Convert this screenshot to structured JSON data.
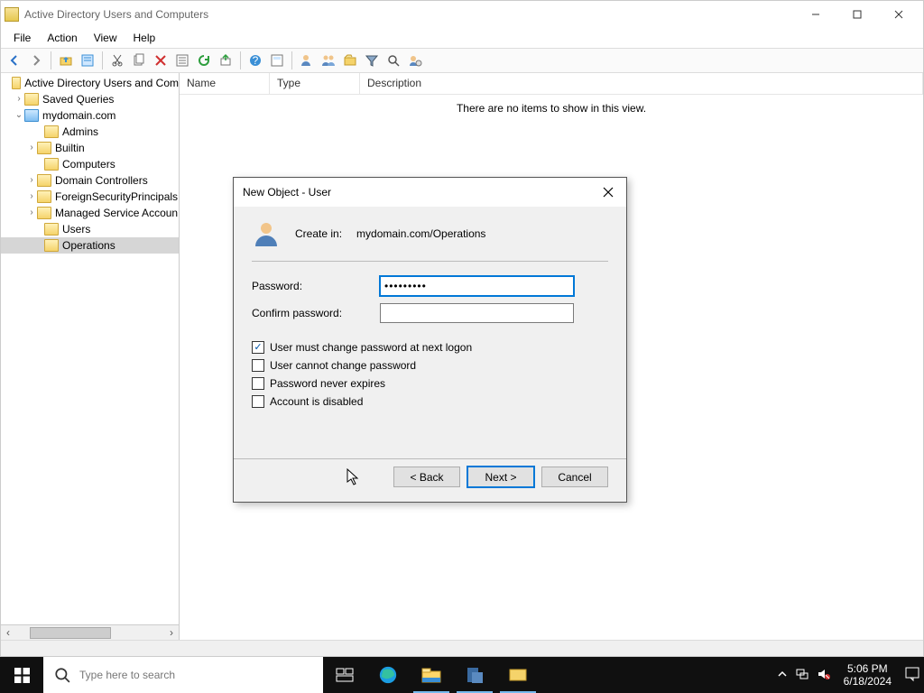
{
  "window": {
    "title": "Active Directory Users and Computers"
  },
  "menu": {
    "file": "File",
    "action": "Action",
    "view": "View",
    "help": "Help"
  },
  "tree": {
    "root": "Active Directory Users and Com",
    "saved_queries": "Saved Queries",
    "domain": "mydomain.com",
    "nodes": {
      "admins": "Admins",
      "builtin": "Builtin",
      "computers": "Computers",
      "dcs": "Domain Controllers",
      "fsp": "ForeignSecurityPrincipals",
      "msa": "Managed Service Accoun",
      "users": "Users",
      "operations": "Operations"
    }
  },
  "list": {
    "cols": {
      "name": "Name",
      "type": "Type",
      "desc": "Description"
    },
    "empty": "There are no items to show in this view."
  },
  "dialog": {
    "title": "New Object - User",
    "create_in_label": "Create in:",
    "create_in_path": "mydomain.com/Operations",
    "password_label": "Password:",
    "confirm_label": "Confirm password:",
    "password_value": "•••••••••",
    "confirm_value": "",
    "opt_change": "User must change password at next logon",
    "opt_cannot": "User cannot change password",
    "opt_never": "Password never expires",
    "opt_disabled": "Account is disabled",
    "back": "< Back",
    "next": "Next >",
    "cancel": "Cancel"
  },
  "taskbar": {
    "search_placeholder": "Type here to search",
    "time": "5:06 PM",
    "date": "6/18/2024"
  }
}
